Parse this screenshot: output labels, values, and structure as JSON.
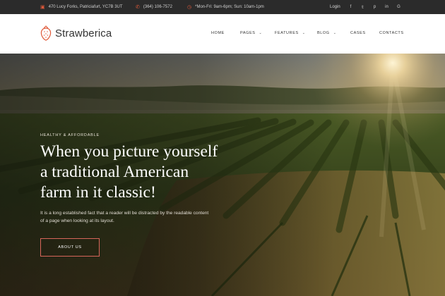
{
  "topbar": {
    "address": "470 Lucy Forks, Patriciafurt, YC7B 3UT",
    "phone": "(364) 106-7572",
    "hours": "*Mon-Fri: 9am-6pm; Sun: 10am-1pm",
    "login": "Login",
    "socials": [
      {
        "name": "facebook-icon",
        "glyph": "f"
      },
      {
        "name": "twitter-icon",
        "glyph": "𝕥"
      },
      {
        "name": "pinterest-icon",
        "glyph": "p"
      },
      {
        "name": "linkedin-icon",
        "glyph": "in"
      },
      {
        "name": "google-icon",
        "glyph": "G"
      }
    ]
  },
  "header": {
    "brand": "Strawberica",
    "nav": [
      {
        "label": "HOME",
        "has_dropdown": false
      },
      {
        "label": "PAGES",
        "has_dropdown": true
      },
      {
        "label": "FEATURES",
        "has_dropdown": true
      },
      {
        "label": "BLOG",
        "has_dropdown": true
      },
      {
        "label": "CASES",
        "has_dropdown": false
      },
      {
        "label": "CONTACTS",
        "has_dropdown": false
      }
    ]
  },
  "hero": {
    "eyebrow": "HEALTHY & AFFORDABLE",
    "headline_lines": [
      "When you picture yourself",
      "a traditional American",
      "farm in it classic!"
    ],
    "lead_lines": [
      "It is a long established fact that a reader will be distracted by the readable content",
      "of a page when looking at its layout."
    ],
    "cta": "ABOUT US"
  },
  "colors": {
    "accent": "#e05a3a",
    "topbar_bg": "#2b2b2b",
    "cta_border": "#d7665a"
  }
}
